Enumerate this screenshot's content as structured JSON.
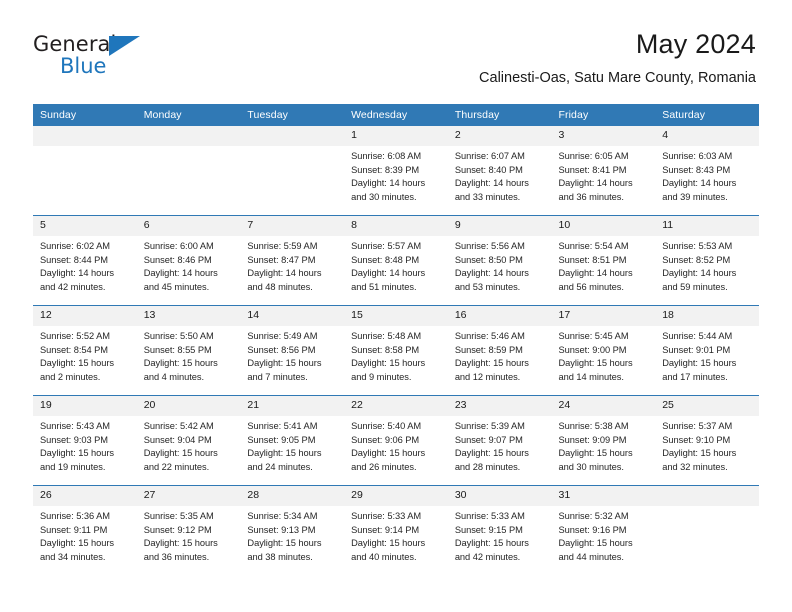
{
  "brand": {
    "name_top": "General",
    "name_bottom": "Blue",
    "accent_color": "#1f76bc",
    "triangle_icon": "triangle-icon"
  },
  "header": {
    "title": "May 2024",
    "subtitle": "Calinesti-Oas, Satu Mare County, Romania"
  },
  "theme": {
    "header_bg": "#3079b5",
    "daynum_bg": "#f2f2f2",
    "row_divider": "#3079b5",
    "text": "#1a1a1a"
  },
  "weekdays": [
    "Sunday",
    "Monday",
    "Tuesday",
    "Wednesday",
    "Thursday",
    "Friday",
    "Saturday"
  ],
  "weeks": [
    [
      {
        "day": "",
        "lines": []
      },
      {
        "day": "",
        "lines": []
      },
      {
        "day": "",
        "lines": []
      },
      {
        "day": "1",
        "lines": [
          "Sunrise: 6:08 AM",
          "Sunset: 8:39 PM",
          "Daylight: 14 hours",
          "and 30 minutes."
        ]
      },
      {
        "day": "2",
        "lines": [
          "Sunrise: 6:07 AM",
          "Sunset: 8:40 PM",
          "Daylight: 14 hours",
          "and 33 minutes."
        ]
      },
      {
        "day": "3",
        "lines": [
          "Sunrise: 6:05 AM",
          "Sunset: 8:41 PM",
          "Daylight: 14 hours",
          "and 36 minutes."
        ]
      },
      {
        "day": "4",
        "lines": [
          "Sunrise: 6:03 AM",
          "Sunset: 8:43 PM",
          "Daylight: 14 hours",
          "and 39 minutes."
        ]
      }
    ],
    [
      {
        "day": "5",
        "lines": [
          "Sunrise: 6:02 AM",
          "Sunset: 8:44 PM",
          "Daylight: 14 hours",
          "and 42 minutes."
        ]
      },
      {
        "day": "6",
        "lines": [
          "Sunrise: 6:00 AM",
          "Sunset: 8:46 PM",
          "Daylight: 14 hours",
          "and 45 minutes."
        ]
      },
      {
        "day": "7",
        "lines": [
          "Sunrise: 5:59 AM",
          "Sunset: 8:47 PM",
          "Daylight: 14 hours",
          "and 48 minutes."
        ]
      },
      {
        "day": "8",
        "lines": [
          "Sunrise: 5:57 AM",
          "Sunset: 8:48 PM",
          "Daylight: 14 hours",
          "and 51 minutes."
        ]
      },
      {
        "day": "9",
        "lines": [
          "Sunrise: 5:56 AM",
          "Sunset: 8:50 PM",
          "Daylight: 14 hours",
          "and 53 minutes."
        ]
      },
      {
        "day": "10",
        "lines": [
          "Sunrise: 5:54 AM",
          "Sunset: 8:51 PM",
          "Daylight: 14 hours",
          "and 56 minutes."
        ]
      },
      {
        "day": "11",
        "lines": [
          "Sunrise: 5:53 AM",
          "Sunset: 8:52 PM",
          "Daylight: 14 hours",
          "and 59 minutes."
        ]
      }
    ],
    [
      {
        "day": "12",
        "lines": [
          "Sunrise: 5:52 AM",
          "Sunset: 8:54 PM",
          "Daylight: 15 hours",
          "and 2 minutes."
        ]
      },
      {
        "day": "13",
        "lines": [
          "Sunrise: 5:50 AM",
          "Sunset: 8:55 PM",
          "Daylight: 15 hours",
          "and 4 minutes."
        ]
      },
      {
        "day": "14",
        "lines": [
          "Sunrise: 5:49 AM",
          "Sunset: 8:56 PM",
          "Daylight: 15 hours",
          "and 7 minutes."
        ]
      },
      {
        "day": "15",
        "lines": [
          "Sunrise: 5:48 AM",
          "Sunset: 8:58 PM",
          "Daylight: 15 hours",
          "and 9 minutes."
        ]
      },
      {
        "day": "16",
        "lines": [
          "Sunrise: 5:46 AM",
          "Sunset: 8:59 PM",
          "Daylight: 15 hours",
          "and 12 minutes."
        ]
      },
      {
        "day": "17",
        "lines": [
          "Sunrise: 5:45 AM",
          "Sunset: 9:00 PM",
          "Daylight: 15 hours",
          "and 14 minutes."
        ]
      },
      {
        "day": "18",
        "lines": [
          "Sunrise: 5:44 AM",
          "Sunset: 9:01 PM",
          "Daylight: 15 hours",
          "and 17 minutes."
        ]
      }
    ],
    [
      {
        "day": "19",
        "lines": [
          "Sunrise: 5:43 AM",
          "Sunset: 9:03 PM",
          "Daylight: 15 hours",
          "and 19 minutes."
        ]
      },
      {
        "day": "20",
        "lines": [
          "Sunrise: 5:42 AM",
          "Sunset: 9:04 PM",
          "Daylight: 15 hours",
          "and 22 minutes."
        ]
      },
      {
        "day": "21",
        "lines": [
          "Sunrise: 5:41 AM",
          "Sunset: 9:05 PM",
          "Daylight: 15 hours",
          "and 24 minutes."
        ]
      },
      {
        "day": "22",
        "lines": [
          "Sunrise: 5:40 AM",
          "Sunset: 9:06 PM",
          "Daylight: 15 hours",
          "and 26 minutes."
        ]
      },
      {
        "day": "23",
        "lines": [
          "Sunrise: 5:39 AM",
          "Sunset: 9:07 PM",
          "Daylight: 15 hours",
          "and 28 minutes."
        ]
      },
      {
        "day": "24",
        "lines": [
          "Sunrise: 5:38 AM",
          "Sunset: 9:09 PM",
          "Daylight: 15 hours",
          "and 30 minutes."
        ]
      },
      {
        "day": "25",
        "lines": [
          "Sunrise: 5:37 AM",
          "Sunset: 9:10 PM",
          "Daylight: 15 hours",
          "and 32 minutes."
        ]
      }
    ],
    [
      {
        "day": "26",
        "lines": [
          "Sunrise: 5:36 AM",
          "Sunset: 9:11 PM",
          "Daylight: 15 hours",
          "and 34 minutes."
        ]
      },
      {
        "day": "27",
        "lines": [
          "Sunrise: 5:35 AM",
          "Sunset: 9:12 PM",
          "Daylight: 15 hours",
          "and 36 minutes."
        ]
      },
      {
        "day": "28",
        "lines": [
          "Sunrise: 5:34 AM",
          "Sunset: 9:13 PM",
          "Daylight: 15 hours",
          "and 38 minutes."
        ]
      },
      {
        "day": "29",
        "lines": [
          "Sunrise: 5:33 AM",
          "Sunset: 9:14 PM",
          "Daylight: 15 hours",
          "and 40 minutes."
        ]
      },
      {
        "day": "30",
        "lines": [
          "Sunrise: 5:33 AM",
          "Sunset: 9:15 PM",
          "Daylight: 15 hours",
          "and 42 minutes."
        ]
      },
      {
        "day": "31",
        "lines": [
          "Sunrise: 5:32 AM",
          "Sunset: 9:16 PM",
          "Daylight: 15 hours",
          "and 44 minutes."
        ]
      },
      {
        "day": "",
        "lines": []
      }
    ]
  ]
}
